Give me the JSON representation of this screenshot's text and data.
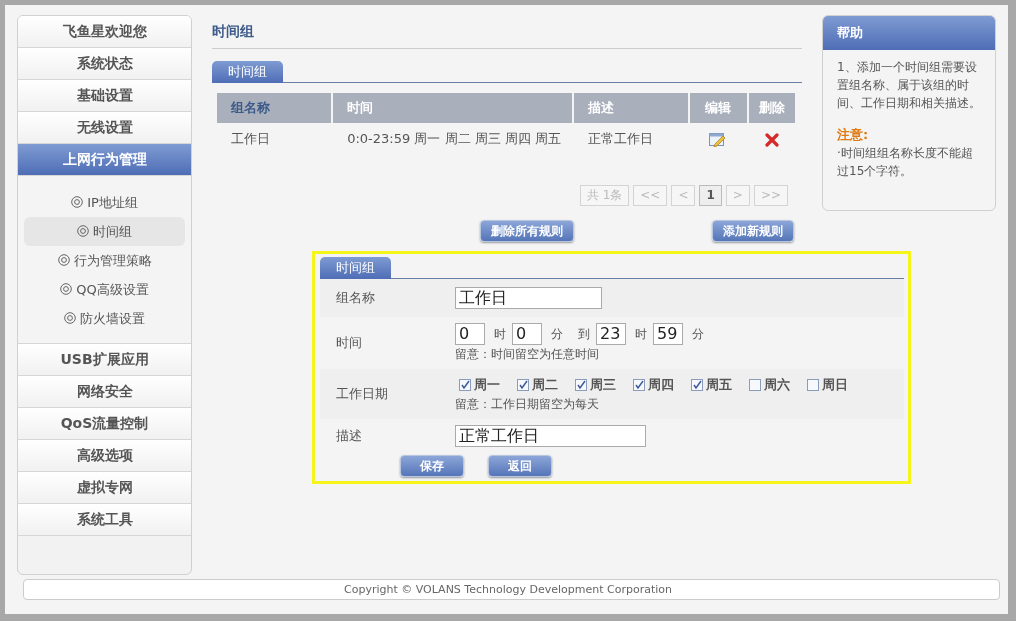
{
  "sidebar": {
    "items": [
      {
        "label": "飞鱼星欢迎您",
        "selected": false
      },
      {
        "label": "系统状态",
        "selected": false
      },
      {
        "label": "基础设置",
        "selected": false
      },
      {
        "label": "无线设置",
        "selected": false
      },
      {
        "label": "上网行为管理",
        "selected": true,
        "children": [
          {
            "label": "IP地址组",
            "selected": false
          },
          {
            "label": "时间组",
            "selected": true
          },
          {
            "label": "行为管理策略",
            "selected": false
          },
          {
            "label": "QQ高级设置",
            "selected": false
          },
          {
            "label": "防火墙设置",
            "selected": false
          }
        ]
      },
      {
        "label": "USB扩展应用",
        "selected": false
      },
      {
        "label": "网络安全",
        "selected": false
      },
      {
        "label": "QoS流量控制",
        "selected": false
      },
      {
        "label": "高级选项",
        "selected": false
      },
      {
        "label": "虚拟专网",
        "selected": false
      },
      {
        "label": "系统工具",
        "selected": false
      }
    ]
  },
  "page_title": "时间组",
  "list_tab": "时间组",
  "table": {
    "columns": [
      "组名称",
      "时间",
      "描述",
      "编辑",
      "删除"
    ],
    "rows": [
      {
        "name": "工作日",
        "time": "0:0-23:59 周一  周二  周三  周四  周五",
        "description": "正常工作日"
      }
    ]
  },
  "pagination": {
    "total": "共 1条",
    "first": "<<",
    "prev": "<",
    "pages": [
      {
        "label": "1",
        "selected": true
      }
    ],
    "next": ">",
    "last": ">>"
  },
  "actions": [
    "删除所有规则",
    "添加新规则"
  ],
  "form": {
    "tab": "时间组",
    "name": {
      "label": "组名称",
      "value": "工作日"
    },
    "time": {
      "label": "时间",
      "start_hour": "0",
      "hour_unit_1": "时",
      "start_minute": "0",
      "minute_unit_1": "分",
      "to": "到",
      "end_hour": "23",
      "hour_unit_2": "时",
      "end_minute": "59",
      "minute_unit_2": "分",
      "hint": "留意：时间留空为任意时间"
    },
    "workdays": {
      "label": "工作日期",
      "days": [
        {
          "label": "周一",
          "checked": true
        },
        {
          "label": "周二",
          "checked": true
        },
        {
          "label": "周三",
          "checked": true
        },
        {
          "label": "周四",
          "checked": true
        },
        {
          "label": "周五",
          "checked": true
        },
        {
          "label": "周六",
          "checked": false
        },
        {
          "label": "周日",
          "checked": false
        }
      ],
      "hint": "留意：工作日期留空为每天"
    },
    "description": {
      "label": "描述",
      "value": "正常工作日"
    },
    "buttons": [
      "保存",
      "返回"
    ]
  },
  "help": {
    "title": "帮助",
    "text": "1、添加一个时间组需要设置组名称、属于该组的时间、工作日期和相关描述。",
    "note_title": "注意:",
    "note": "·时间组组名称长度不能超过15个字符。"
  },
  "footer": "Copyright © VOLANS Technology Development Corporation"
}
